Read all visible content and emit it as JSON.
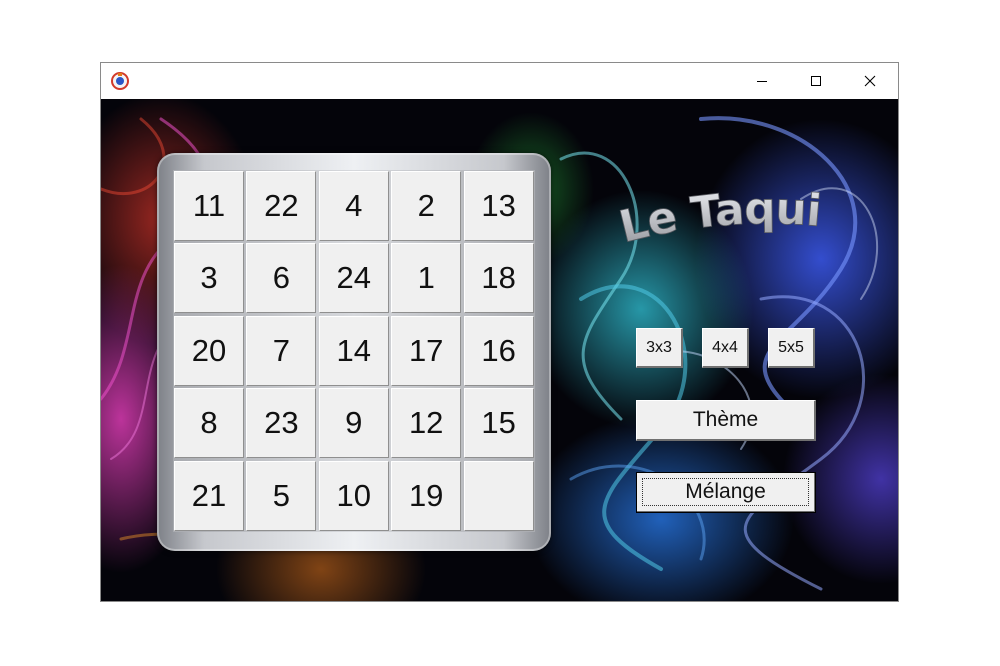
{
  "window": {
    "icon": "app-logo-icon",
    "controls": {
      "minimize": "minimize-icon",
      "maximize": "maximize-icon",
      "close": "close-icon"
    }
  },
  "game": {
    "title": "Le Taquin",
    "size": 5,
    "tiles": [
      [
        "11",
        "22",
        "4",
        "2",
        "13"
      ],
      [
        "3",
        "6",
        "24",
        "1",
        "18"
      ],
      [
        "20",
        "7",
        "14",
        "17",
        "16"
      ],
      [
        "8",
        "23",
        "9",
        "12",
        "15"
      ],
      [
        "21",
        "5",
        "10",
        "19",
        ""
      ]
    ]
  },
  "controls": {
    "size_3": "3x3",
    "size_4": "4x4",
    "size_5": "5x5",
    "theme": "Thème",
    "shuffle": "Mélange"
  }
}
